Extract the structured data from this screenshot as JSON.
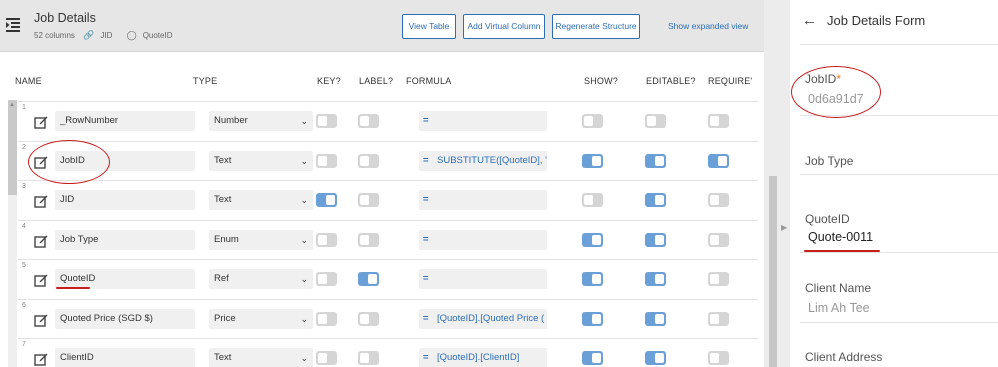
{
  "editor": {
    "title": "Job Details",
    "meta": {
      "columns": "52 columns",
      "key": "JID",
      "label": "QuoteID"
    },
    "buttons": {
      "view_table": "View Table",
      "add_virtual": "Add Virtual Column",
      "regenerate": "Regenerate Structure"
    },
    "expanded_link": "Show expanded view",
    "headers": [
      "NAME",
      "TYPE",
      "KEY?",
      "LABEL?",
      "FORMULA",
      "SHOW?",
      "EDITABLE?",
      "REQUIRE'"
    ],
    "rows": [
      {
        "num": "1",
        "name": "_RowNumber",
        "type": "Number",
        "key": false,
        "label": false,
        "formula": "",
        "show": false,
        "editable": false,
        "required": false
      },
      {
        "num": "2",
        "name": "JobID",
        "type": "Text",
        "key": false,
        "label": false,
        "formula": "SUBSTITUTE([QuoteID], \"",
        "show": true,
        "editable": true,
        "required": true
      },
      {
        "num": "3",
        "name": "JID",
        "type": "Text",
        "key": true,
        "label": false,
        "formula": "",
        "show": false,
        "editable": true,
        "required": false
      },
      {
        "num": "4",
        "name": "Job Type",
        "type": "Enum",
        "key": false,
        "label": false,
        "formula": "",
        "show": true,
        "editable": true,
        "required": false
      },
      {
        "num": "5",
        "name": "QuoteID",
        "type": "Ref",
        "key": false,
        "label": true,
        "formula": "",
        "show": true,
        "editable": true,
        "required": false
      },
      {
        "num": "6",
        "name": "Quoted Price (SGD $)",
        "type": "Price",
        "key": false,
        "label": false,
        "formula": "[QuoteID].[Quoted Price (",
        "show": true,
        "editable": true,
        "required": false
      },
      {
        "num": "7",
        "name": "ClientID",
        "type": "Text",
        "key": false,
        "label": false,
        "formula": "[QuoteID].[ClientID]",
        "show": true,
        "editable": true,
        "required": false
      }
    ],
    "colors": {
      "toggle_on": "#6a9fd8",
      "toggle_off": "#d5d5d5",
      "accent": "#2d6db5",
      "annotation": "#c81e1e"
    }
  },
  "form": {
    "title": "Job Details Form",
    "fields": [
      {
        "label": "JobID",
        "required_mark": "*",
        "value": "0d6a91d7"
      },
      {
        "label": "Job Type",
        "value": ""
      },
      {
        "label": "QuoteID",
        "value": "Quote-0011"
      },
      {
        "label": "Client Name",
        "value": "Lim Ah Tee"
      },
      {
        "label": "Client Address",
        "value": ""
      }
    ]
  }
}
